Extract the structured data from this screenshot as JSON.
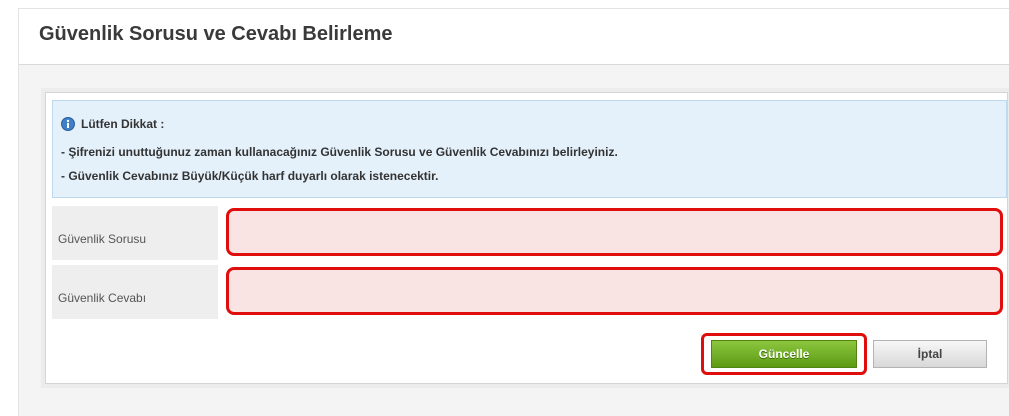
{
  "header": {
    "title": "Güvenlik Sorusu ve Cevabı Belirleme"
  },
  "notice": {
    "icon": "info-icon",
    "title": "Lütfen Dikkat :",
    "lines": [
      "- Şifrenizi unuttuğunuz zaman kullanacağınız Güvenlik Sorusu ve Güvenlik Cevabınızı belirleyiniz.",
      "- Güvenlik Cevabınız Büyük/Küçük harf duyarlı olarak istenecektir."
    ]
  },
  "form": {
    "question": {
      "label": "Güvenlik Sorusu",
      "value": "",
      "placeholder": ""
    },
    "answer": {
      "label": "Güvenlik Cevabı",
      "value": "",
      "placeholder": ""
    }
  },
  "actions": {
    "update_label": "Güncelle",
    "cancel_label": "İptal"
  },
  "colors": {
    "highlight": "#e00d0d",
    "update_button": "#6aab1f",
    "notice_background": "#e4f1fb",
    "input_background": "#f9e3e3"
  }
}
